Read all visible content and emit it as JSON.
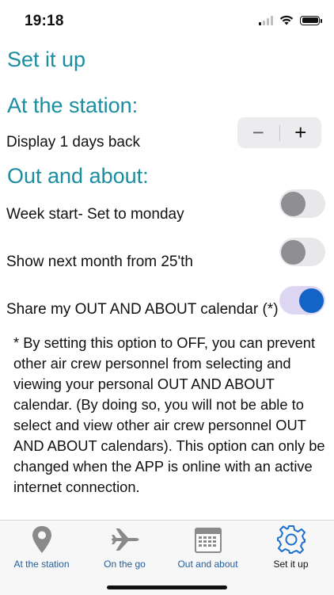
{
  "status": {
    "time": "19:18"
  },
  "page": {
    "title": "Set it up"
  },
  "station": {
    "title": "At the station:",
    "display_label": "Display 1 days back",
    "minus": "−",
    "plus": "+"
  },
  "out": {
    "title": "Out and about:",
    "week_start_label": "Week start- Set to monday",
    "week_start_on": false,
    "next_month_label": "Show next month from 25'th",
    "next_month_on": false,
    "share_label": "Share my OUT AND ABOUT calendar (*)",
    "share_on": true
  },
  "note": "* By setting this option to OFF, you can prevent other air crew personnel from selecting and viewing your personal OUT AND ABOUT calendar. (By doing so, you will not be able to select and view other air crew personnel OUT AND ABOUT calendars). This option can only be changed when the APP is online with an active internet connection.",
  "tabs": [
    {
      "label": "At the station",
      "icon": "location-pin-icon"
    },
    {
      "label": "On the go",
      "icon": "airplane-icon"
    },
    {
      "label": "Out and about",
      "icon": "calendar-icon"
    },
    {
      "label": "Set it up",
      "icon": "gear-icon"
    }
  ],
  "colors": {
    "accent": "#1a8ea0",
    "tab_label": "#1f5e9c",
    "toggle_on": "#1464c8",
    "toggle_on_track": "#dcd6f3"
  }
}
